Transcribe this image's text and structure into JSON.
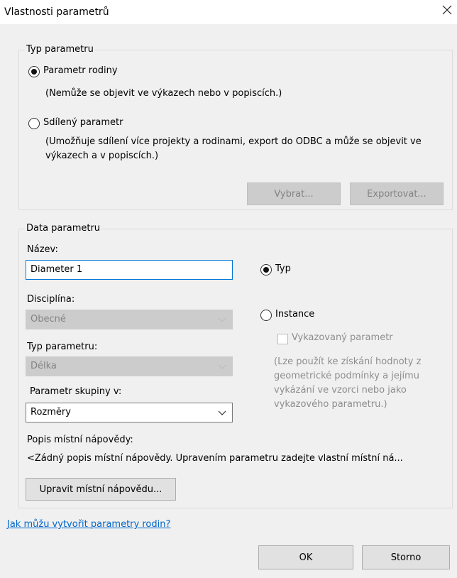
{
  "window": {
    "title": "Vlastnosti parametrů"
  },
  "param_type": {
    "legend": "Typ parametru",
    "family_label": "Parametr rodiny",
    "family_checked": true,
    "family_desc": "(Nemůže se objevit ve výkazech nebo v popiscích.)",
    "shared_label": "Sdílený parametr",
    "shared_checked": false,
    "shared_desc": "(Umožňuje sdílení více projekty a rodinami, export do ODBC a může se objevit ve výkazech a v popiscích.)",
    "select_button": "Vybrat...",
    "export_button": "Exportovat..."
  },
  "param_data": {
    "legend": "Data parametru",
    "name_label": "Název:",
    "name_value": "Diameter 1",
    "discipline_label": "Disciplína:",
    "discipline_value": "Obecné",
    "type_label": "Typ parametru:",
    "type_value": "Délka",
    "group_label": "Parametr skupiny v:",
    "group_value": "Rozměry",
    "radio_type_label": "Typ",
    "radio_type_checked": true,
    "radio_instance_label": "Instance",
    "radio_instance_checked": false,
    "reporting_label": "Vykazovaný parametr",
    "reporting_desc": "(Lze použít ke získání hodnoty z geometrické podmínky a jejímu vykázání ve vzorci nebo jako vykazového parametru.)",
    "tooltip_label": "Popis místní nápovědy:",
    "tooltip_text": "<Žádný popis místní nápovědy. Upravením parametru zadejte vlastní místní ná...",
    "edit_tooltip_button": "Upravit místní nápovědu..."
  },
  "help_link": "Jak můžu vytvořit parametry rodin?",
  "footer": {
    "ok_button": "OK",
    "cancel_button": "Storno"
  }
}
